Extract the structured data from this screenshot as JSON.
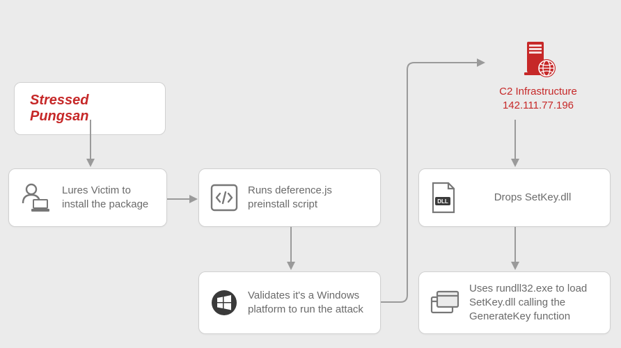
{
  "title": "Stressed Pungsan",
  "c2": {
    "label": "C2 Infrastructure",
    "ip": "142.111.77.196"
  },
  "nodes": {
    "lure": "Lures Victim to install the package",
    "deference": "Runs deference.js preinstall  script",
    "validate": "Validates it's a Windows platform to run the attack",
    "drops": "Drops SetKey.dll",
    "rundll": "Uses rundll32.exe to load SetKey.dll calling the GenerateKey function"
  }
}
